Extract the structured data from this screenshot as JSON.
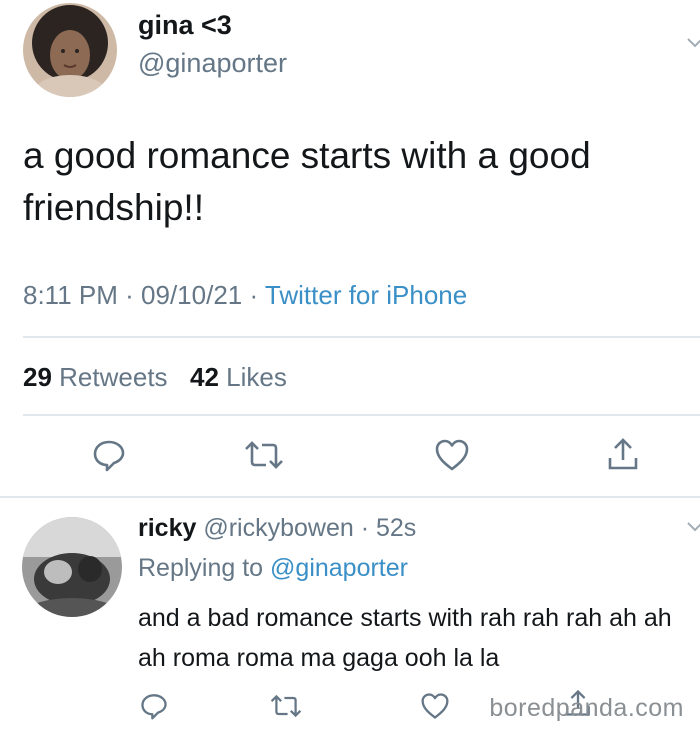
{
  "tweet": {
    "author_name": "gina <3",
    "author_handle": "@ginaporter",
    "text": "a good romance starts with a good friendship!!",
    "time": "8:11 PM",
    "date": "09/10/21",
    "source": "Twitter for iPhone",
    "retweets_count": "29",
    "retweets_label": "Retweets",
    "likes_count": "42",
    "likes_label": "Likes"
  },
  "reply": {
    "author_name": "ricky",
    "author_handle": "@rickybowen",
    "time_ago": "52s",
    "replying_prefix": "Replying to",
    "replying_to": "@ginaporter",
    "text": "and a bad romance starts with rah rah rah ah ah ah roma roma ma gaga ooh la la"
  },
  "icons": {
    "reply": "comment-icon",
    "retweet": "retweet-icon",
    "like": "heart-icon",
    "share": "share-icon",
    "more": "chevron-down-icon"
  },
  "colors": {
    "text": "#14171a",
    "secondary": "#657786",
    "link": "#3a8fc7",
    "divider": "#e1e8ed"
  },
  "watermark": "boredpanda.com"
}
